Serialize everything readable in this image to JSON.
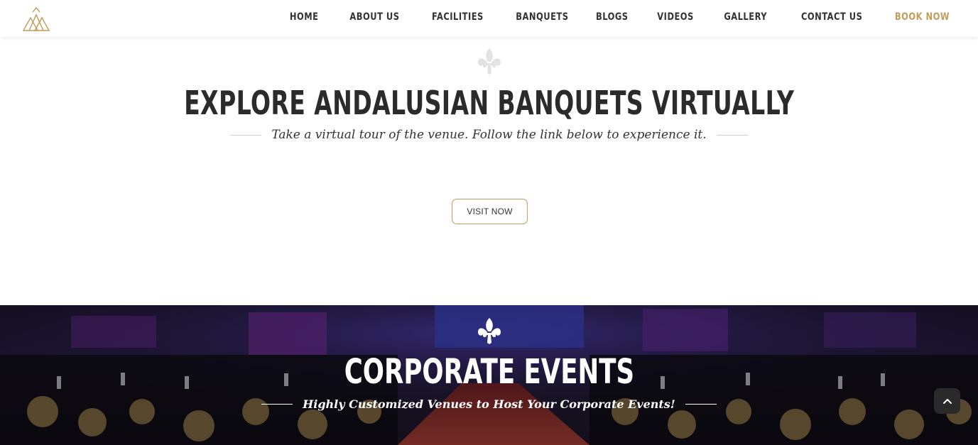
{
  "header": {
    "nav": [
      {
        "label": "HOME"
      },
      {
        "label": "ABOUT US"
      },
      {
        "label": "FACILITIES"
      },
      {
        "label": "BANQUETS"
      },
      {
        "label": "BLOGS"
      },
      {
        "label": "VIDEOS"
      },
      {
        "label": "GALLERY"
      },
      {
        "label": "CONTACT US"
      },
      {
        "label": "BOOK NOW"
      }
    ],
    "logo_icon": "triangle-logo-icon"
  },
  "explore": {
    "ornament_icon": "fleur-de-lis-icon",
    "title": "EXPLORE ANDALUSIAN BANQUETS VIRTUALLY",
    "subtitle": "Take a virtual tour of the venue. Follow the link below to experience it.",
    "button_label": "VISIT NOW"
  },
  "corporate": {
    "ornament_icon": "fleur-de-lis-icon",
    "title": "CORPORATE EVENTS",
    "subtitle": "Highly Customized Venues to Host Your Corporate Events!"
  },
  "scroll_top_icon": "chevron-up-icon",
  "colors": {
    "accent": "#c29c5c",
    "nav_text": "#333333",
    "title_text": "#2b2b2b"
  }
}
